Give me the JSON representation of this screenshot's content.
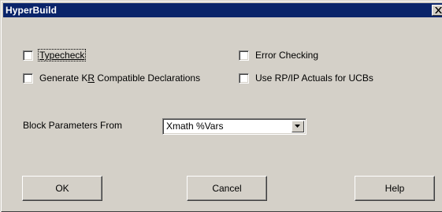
{
  "window": {
    "title": "HyperBuild"
  },
  "options": {
    "typecheck": {
      "label": "Typecheck",
      "checked": false
    },
    "kr_compatible": {
      "label_pre": "Generate K",
      "label_ul": "R",
      "label_post": " Compatible Declarations",
      "checked": false
    },
    "error_checking": {
      "label": "Error Checking",
      "checked": false
    },
    "rp_ip_actuals": {
      "label": "Use RP/IP Actuals for UCBs",
      "checked": false
    }
  },
  "block_params": {
    "label": "Block Parameters From",
    "selected": "Xmath %Vars"
  },
  "buttons": {
    "ok": "OK",
    "cancel": "Cancel",
    "help": "Help"
  },
  "colors": {
    "titlebar": "#0a246a",
    "face": "#d4d0c8",
    "title_text": "#ffffff"
  },
  "icons": {
    "close": "close-icon",
    "dropdown": "chevron-down-icon"
  }
}
